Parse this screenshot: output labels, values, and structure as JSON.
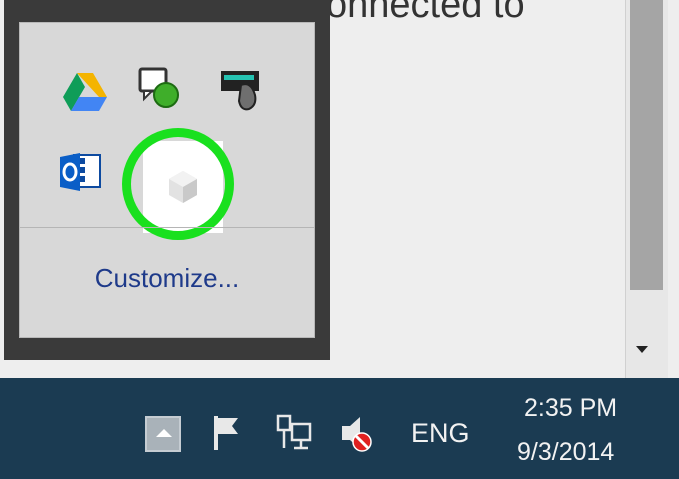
{
  "background_document": {
    "partial_text": "onnected to"
  },
  "overflow_popup": {
    "icons": [
      {
        "name": "google-drive-icon"
      },
      {
        "name": "chat-status-icon"
      },
      {
        "name": "card-reader-icon"
      },
      {
        "name": "outlook-icon"
      },
      {
        "name": "app-tray-icon",
        "highlighted": true
      }
    ],
    "customize_label": "Customize...",
    "highlight_color": "#19e01e"
  },
  "taskbar": {
    "show_hidden_icons": "show-hidden-icons-button",
    "icons": [
      {
        "name": "action-center-flag-icon"
      },
      {
        "name": "network-icon"
      },
      {
        "name": "volume-muted-icon"
      }
    ],
    "language": "ENG",
    "time": "2:35 PM",
    "date": "9/3/2014",
    "background_color": "#1b3b52"
  }
}
